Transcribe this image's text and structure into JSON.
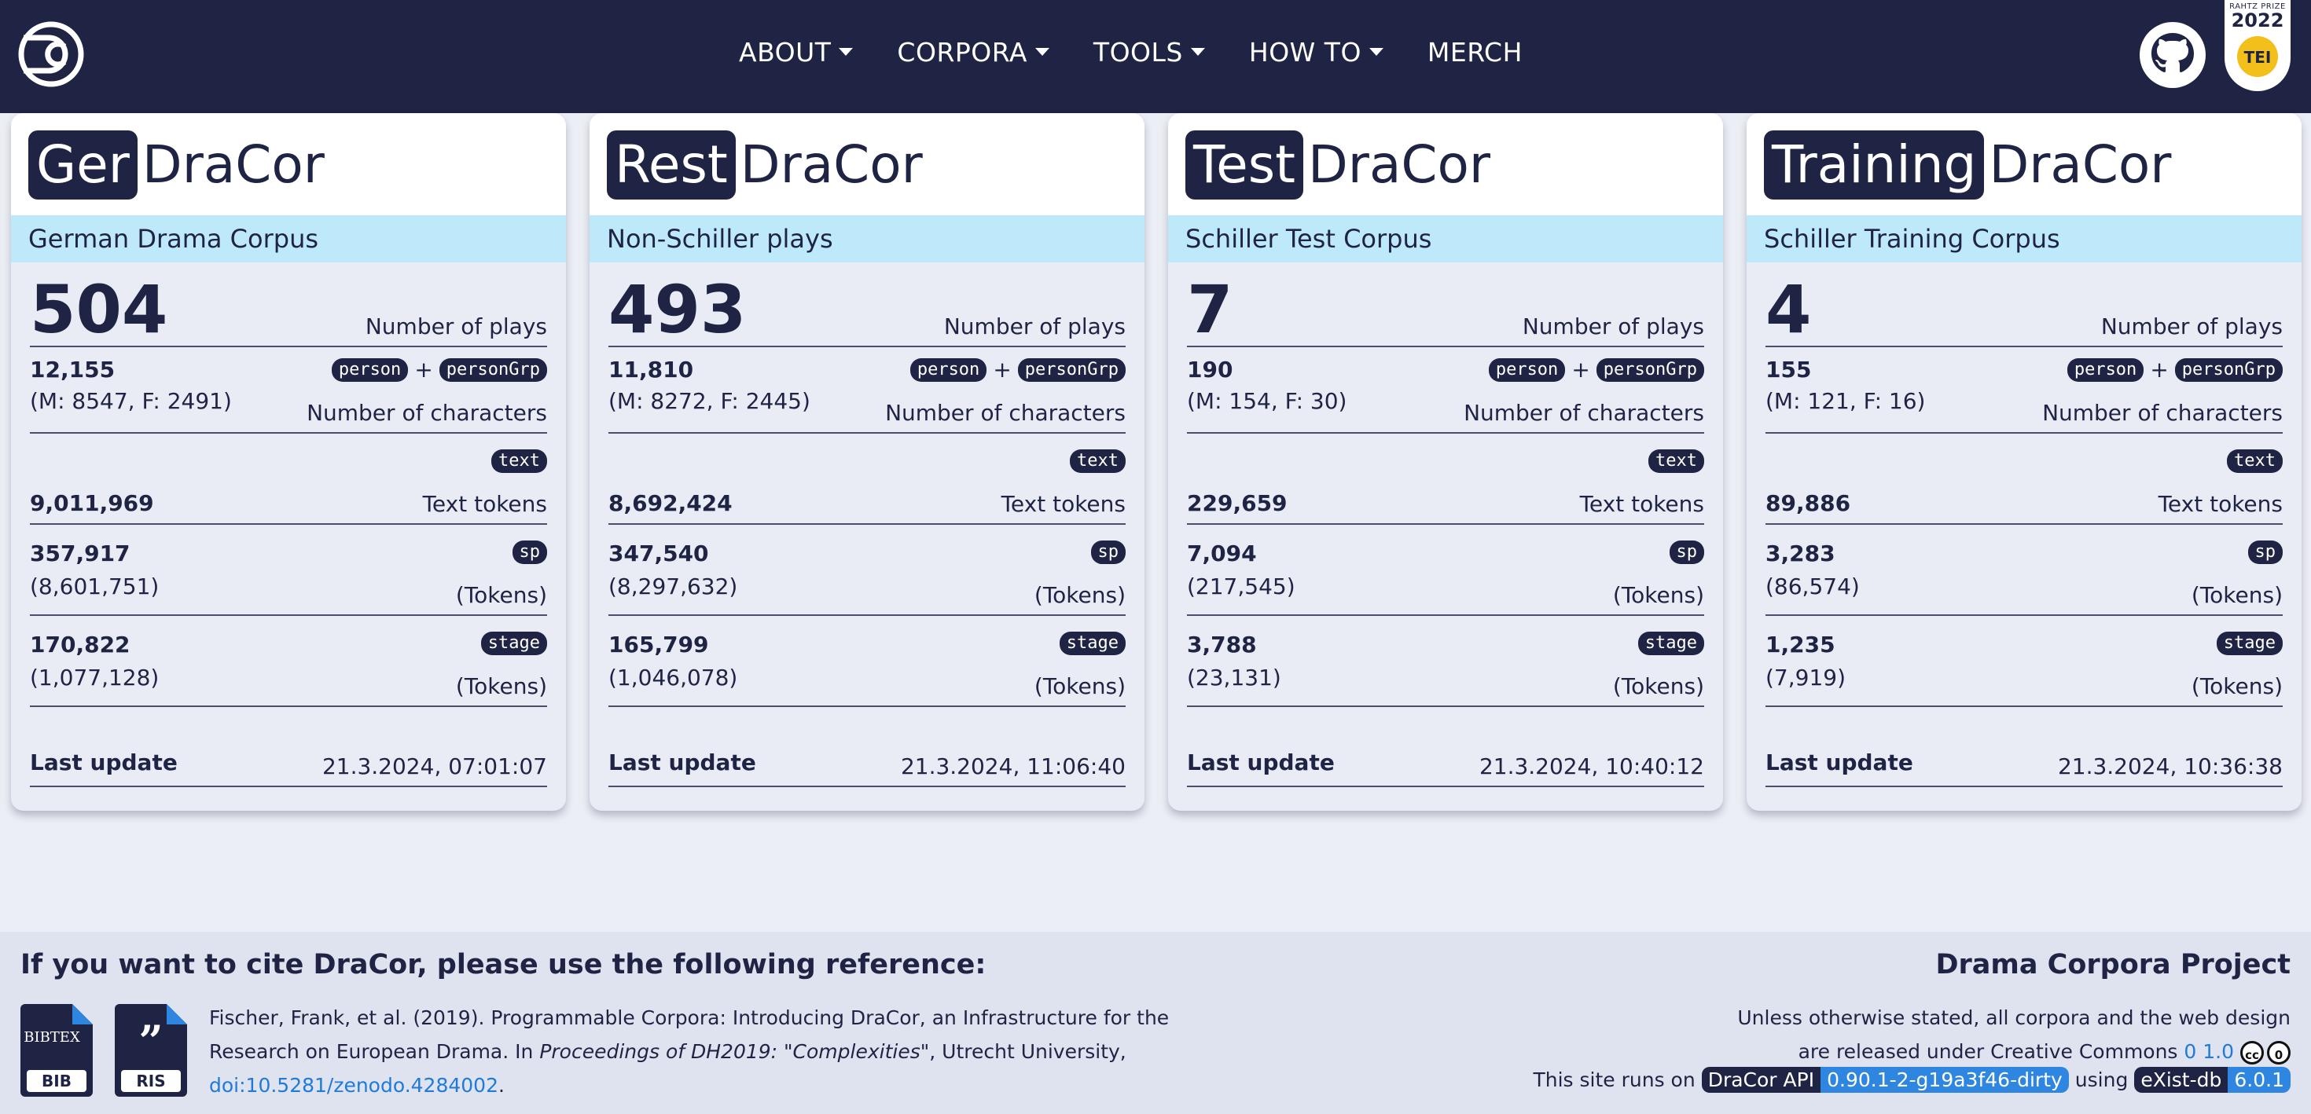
{
  "nav": {
    "items": [
      {
        "label": "ABOUT",
        "dropdown": true
      },
      {
        "label": "CORPORA",
        "dropdown": true
      },
      {
        "label": "TOOLS",
        "dropdown": true
      },
      {
        "label": "HOW TO",
        "dropdown": true
      },
      {
        "label": "MERCH",
        "dropdown": false
      }
    ],
    "icons": [
      "dracor-logo-icon",
      "github-icon",
      "tei-prize-badge"
    ]
  },
  "tei_badge": {
    "line1": "RAHTZ PRIZE",
    "year": "2022",
    "mark": "TEI"
  },
  "corpora": [
    {
      "prefix": "Ger",
      "suffix": "DraCor",
      "subtitle": "German Drama Corpus",
      "plays": "504",
      "plays_label": "Number of plays",
      "characters": "12,155",
      "characters_split": "(M: 8547, F: 2491)",
      "characters_label": "Number of characters",
      "pill_person": "person",
      "pill_plus": "+",
      "pill_persongrp": "personGrp",
      "pill_text": "text",
      "text_tokens": "9,011,969",
      "text_tokens_label": "Text tokens",
      "pill_sp": "sp",
      "sp_count": "357,917",
      "sp_tokens": "(8,601,751)",
      "sp_tokens_label": "(Tokens)",
      "pill_stage": "stage",
      "stage_count": "170,822",
      "stage_tokens": "(1,077,128)",
      "stage_tokens_label": "(Tokens)",
      "last_update_label": "Last update",
      "last_update": "21.3.2024, 07:01:07"
    },
    {
      "prefix": "Rest",
      "suffix": "DraCor",
      "subtitle": "Non-Schiller plays",
      "plays": "493",
      "plays_label": "Number of plays",
      "characters": "11,810",
      "characters_split": "(M: 8272, F: 2445)",
      "characters_label": "Number of characters",
      "pill_person": "person",
      "pill_plus": "+",
      "pill_persongrp": "personGrp",
      "pill_text": "text",
      "text_tokens": "8,692,424",
      "text_tokens_label": "Text tokens",
      "pill_sp": "sp",
      "sp_count": "347,540",
      "sp_tokens": "(8,297,632)",
      "sp_tokens_label": "(Tokens)",
      "pill_stage": "stage",
      "stage_count": "165,799",
      "stage_tokens": "(1,046,078)",
      "stage_tokens_label": "(Tokens)",
      "last_update_label": "Last update",
      "last_update": "21.3.2024, 11:06:40"
    },
    {
      "prefix": "Test",
      "suffix": "DraCor",
      "subtitle": "Schiller Test Corpus",
      "plays": "7",
      "plays_label": "Number of plays",
      "characters": "190",
      "characters_split": "(M: 154, F: 30)",
      "characters_label": "Number of characters",
      "pill_person": "person",
      "pill_plus": "+",
      "pill_persongrp": "personGrp",
      "pill_text": "text",
      "text_tokens": "229,659",
      "text_tokens_label": "Text tokens",
      "pill_sp": "sp",
      "sp_count": "7,094",
      "sp_tokens": "(217,545)",
      "sp_tokens_label": "(Tokens)",
      "pill_stage": "stage",
      "stage_count": "3,788",
      "stage_tokens": "(23,131)",
      "stage_tokens_label": "(Tokens)",
      "last_update_label": "Last update",
      "last_update": "21.3.2024, 10:40:12"
    },
    {
      "prefix": "Training",
      "suffix": "DraCor",
      "subtitle": "Schiller Training Corpus",
      "plays": "4",
      "plays_label": "Number of plays",
      "characters": "155",
      "characters_split": "(M: 121, F: 16)",
      "characters_label": "Number of characters",
      "pill_person": "person",
      "pill_plus": "+",
      "pill_persongrp": "personGrp",
      "pill_text": "text",
      "text_tokens": "89,886",
      "text_tokens_label": "Text tokens",
      "pill_sp": "sp",
      "sp_count": "3,283",
      "sp_tokens": "(86,574)",
      "sp_tokens_label": "(Tokens)",
      "pill_stage": "stage",
      "stage_count": "1,235",
      "stage_tokens": "(7,919)",
      "stage_tokens_label": "(Tokens)",
      "last_update_label": "Last update",
      "last_update": "21.3.2024, 10:36:38"
    }
  ],
  "footer": {
    "cite_heading": "If you want to cite DraCor, please use the following reference:",
    "bib_label": "BIB",
    "bib_logo": "BIBTEX",
    "ris_label": "RIS",
    "citation_part1": "Fischer, Frank, et al. (2019). Programmable Corpora: Introducing DraCor, an Infrastructure for the Research on European Drama. In ",
    "citation_italic": "Proceedings of DH2019: \"Complexities\"",
    "citation_part2": ", Utrecht University, ",
    "citation_doi": "doi:10.5281/zenodo.4284002",
    "citation_end": ".",
    "project_name": "Drama Corpora Project",
    "license_line1": "Unless otherwise stated, all corpora and the web design",
    "license_line2": "are released under Creative Commons ",
    "license_link": "0 1.0",
    "runs_on": "This site runs on",
    "api_label": "DraCor API",
    "api_version": "0.90.1-2-g19a3f46-dirty",
    "using": "using",
    "db_label": "eXist-db",
    "db_version": "6.0.1"
  },
  "colors": {
    "navy": "#1f2344",
    "light_blue": "#bde9fb",
    "link": "#1f7ad8",
    "page_bg": "#eceef5"
  }
}
